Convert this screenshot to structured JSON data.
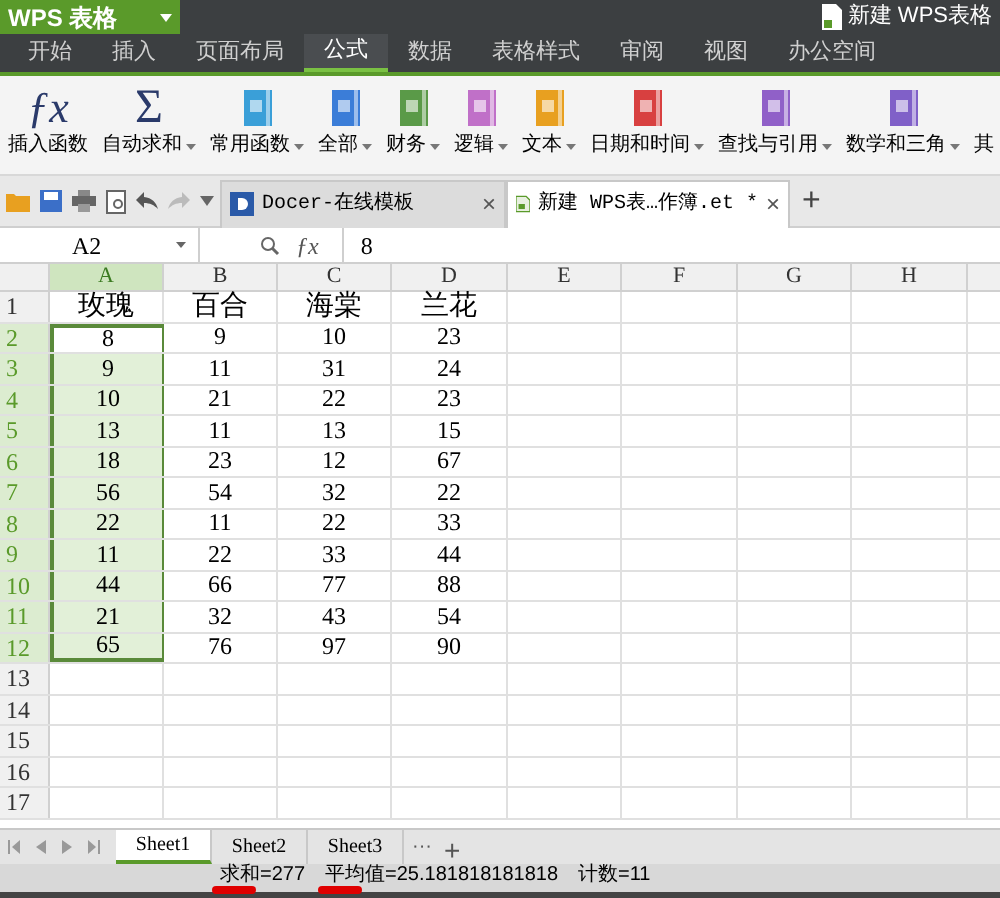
{
  "app_button": {
    "label": "WPS 表格"
  },
  "title": {
    "label": "新建 WPS表格"
  },
  "menu_tabs": [
    {
      "label": "开始",
      "selected": false
    },
    {
      "label": "插入",
      "selected": false
    },
    {
      "label": "页面布局",
      "selected": false
    },
    {
      "label": "公式",
      "selected": true
    },
    {
      "label": "数据",
      "selected": false
    },
    {
      "label": "表格样式",
      "selected": false
    },
    {
      "label": "审阅",
      "selected": false
    },
    {
      "label": "视图",
      "selected": false
    },
    {
      "label": "办公空间",
      "selected": false
    }
  ],
  "ribbon": [
    {
      "label": "插入函数",
      "kind": "fx",
      "icon": "ƒx",
      "dropdown": false
    },
    {
      "label": "自动求和",
      "kind": "sum",
      "icon": "Σ",
      "dropdown": true
    },
    {
      "label": "常用函数",
      "kind": "book",
      "color": "#3a9fd8",
      "dropdown": true
    },
    {
      "label": "全部",
      "kind": "book",
      "color": "#3b7dd8",
      "dropdown": true
    },
    {
      "label": "财务",
      "kind": "book",
      "color": "#5a9a48",
      "dropdown": true
    },
    {
      "label": "逻辑",
      "kind": "book",
      "color": "#c070c8",
      "dropdown": true
    },
    {
      "label": "文本",
      "kind": "book",
      "color": "#e8a020",
      "dropdown": true
    },
    {
      "label": "日期和时间",
      "kind": "book",
      "color": "#d84040",
      "dropdown": true
    },
    {
      "label": "查找与引用",
      "kind": "book",
      "color": "#9060c8",
      "dropdown": true
    },
    {
      "label": "数学和三角",
      "kind": "book",
      "color": "#8060c8",
      "dropdown": true
    },
    {
      "label": "其",
      "kind": "label",
      "dropdown": false
    }
  ],
  "doc_tabs": [
    {
      "label": "Docer-在线模板",
      "close": "×",
      "selected": false
    },
    {
      "label": "新建 WPS表…作簿.et *",
      "close": "×",
      "selected": true
    }
  ],
  "new_tab": "+",
  "name_box": "A2",
  "formula_icon": "ƒx",
  "formula": "8",
  "columns": [
    {
      "label": "A",
      "selected": true
    },
    {
      "label": "B",
      "selected": false
    },
    {
      "label": "C",
      "selected": false
    },
    {
      "label": "D",
      "selected": false
    },
    {
      "label": "E",
      "selected": false
    },
    {
      "label": "F",
      "selected": false
    },
    {
      "label": "G",
      "selected": false
    },
    {
      "label": "H",
      "selected": false
    }
  ],
  "rows": [
    {
      "number": "1",
      "selected": false,
      "active": false,
      "cells": [
        "玫瑰",
        "百合",
        "海棠",
        "兰花"
      ]
    },
    {
      "number": "2",
      "selected": true,
      "active": true,
      "cells": [
        "8",
        "9",
        "10",
        "23"
      ]
    },
    {
      "number": "3",
      "selected": true,
      "active": false,
      "cells": [
        "9",
        "11",
        "31",
        "24"
      ]
    },
    {
      "number": "4",
      "selected": true,
      "active": false,
      "cells": [
        "10",
        "21",
        "22",
        "23"
      ]
    },
    {
      "number": "5",
      "selected": true,
      "active": false,
      "cells": [
        "13",
        "11",
        "13",
        "15"
      ]
    },
    {
      "number": "6",
      "selected": true,
      "active": false,
      "cells": [
        "18",
        "23",
        "12",
        "67"
      ]
    },
    {
      "number": "7",
      "selected": true,
      "active": false,
      "cells": [
        "56",
        "54",
        "32",
        "22"
      ]
    },
    {
      "number": "8",
      "selected": true,
      "active": false,
      "cells": [
        "22",
        "11",
        "22",
        "33"
      ]
    },
    {
      "number": "9",
      "selected": true,
      "active": false,
      "cells": [
        "11",
        "22",
        "33",
        "44"
      ]
    },
    {
      "number": "10",
      "selected": true,
      "active": false,
      "cells": [
        "44",
        "66",
        "77",
        "88"
      ]
    },
    {
      "number": "11",
      "selected": true,
      "active": false,
      "cells": [
        "21",
        "32",
        "43",
        "54"
      ]
    },
    {
      "number": "12",
      "selected": true,
      "active": false,
      "cells": [
        "65",
        "76",
        "97",
        "90"
      ]
    },
    {
      "number": "13",
      "selected": false,
      "active": false,
      "cells": []
    },
    {
      "number": "14",
      "selected": false,
      "active": false,
      "cells": []
    },
    {
      "number": "15",
      "selected": false,
      "active": false,
      "cells": []
    },
    {
      "number": "16",
      "selected": false,
      "active": false,
      "cells": []
    },
    {
      "number": "17",
      "selected": false,
      "active": false,
      "cells": []
    }
  ],
  "sheet_tabs": [
    {
      "label": "Sheet1",
      "selected": true
    },
    {
      "label": "Sheet2",
      "selected": false
    },
    {
      "label": "Sheet3",
      "selected": false
    }
  ],
  "sheet_more": "···",
  "sheet_add": "+",
  "status": [
    {
      "text": "求和=277",
      "marked": true
    },
    {
      "text": "平均值=25.181818181818",
      "marked": true
    },
    {
      "text": "计数=11",
      "marked": false
    }
  ]
}
